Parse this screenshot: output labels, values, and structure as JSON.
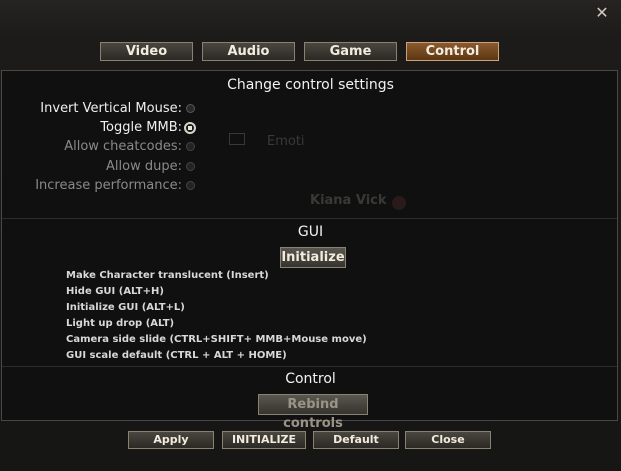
{
  "window": {
    "close_glyph": "✕",
    "tabs": [
      {
        "label": "Video",
        "active": false
      },
      {
        "label": "Audio",
        "active": false
      },
      {
        "label": "Game",
        "active": false
      },
      {
        "label": "Control",
        "active": true
      }
    ]
  },
  "control_settings": {
    "title": "Change control settings",
    "options": [
      {
        "label": "Invert Vertical Mouse:",
        "checked": false,
        "disabled": false
      },
      {
        "label": "Toggle MMB:",
        "checked": true,
        "disabled": false
      },
      {
        "label": "Allow cheatcodes:",
        "checked": false,
        "disabled": true
      },
      {
        "label": "Allow dupe:",
        "checked": false,
        "disabled": true
      },
      {
        "label": "Increase performance:",
        "checked": false,
        "disabled": true
      }
    ]
  },
  "background_ghost": {
    "row_text": "Emoti",
    "name_text": "Kiana Vick"
  },
  "gui_section": {
    "title": "GUI",
    "initialize_button": "Initialize",
    "shortcuts": [
      "Make Character translucent (Insert)",
      "Hide GUI (ALT+H)",
      "Initialize GUI (ALT+L)",
      "Light up drop (ALT)",
      "Camera side slide (CTRL+SHIFT+ MMB+Mouse move)",
      "GUI scale default (CTRL + ALT + HOME)"
    ]
  },
  "control_section": {
    "title": "Control",
    "rebind_button": "Rebind controls"
  },
  "footer": {
    "apply": "Apply",
    "initialize": "INITIALIZE",
    "default": "Default",
    "close": "Close"
  },
  "colors": {
    "active_tab": "#7a4a22",
    "panel_bg": "#101010",
    "border": "#8a8170"
  }
}
